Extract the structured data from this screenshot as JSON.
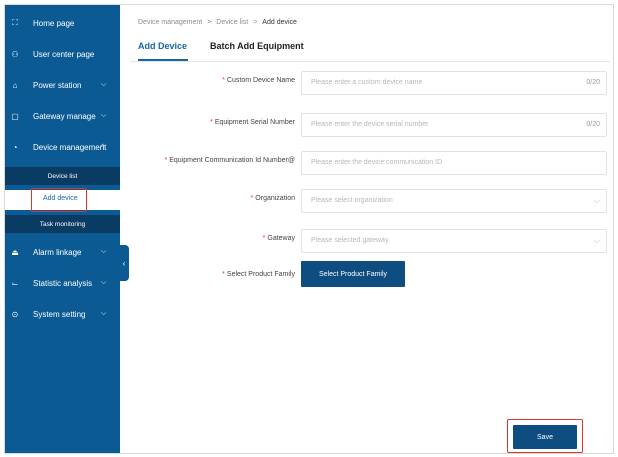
{
  "sidebar": {
    "items": [
      {
        "label": "Home page",
        "icon": "expand-icon",
        "glyph": "⛶",
        "chev": ""
      },
      {
        "label": "User center page",
        "icon": "user-icon",
        "glyph": "⚇",
        "chev": ""
      },
      {
        "label": "Power station",
        "icon": "home-icon",
        "glyph": "⌂",
        "chev": "⌵"
      },
      {
        "label": "Gateway manage",
        "icon": "gateway-icon",
        "glyph": "▢",
        "chev": "⌵"
      },
      {
        "label": "Device management",
        "icon": "device-icon",
        "glyph": "◔",
        "chev": "^"
      },
      {
        "label": "Alarm linkage",
        "icon": "alarm-icon",
        "glyph": "⏏",
        "chev": "⌵"
      },
      {
        "label": "Statistic analysis",
        "icon": "chart-icon",
        "glyph": "⌙",
        "chev": "⌵"
      },
      {
        "label": "System setting",
        "icon": "setting-icon",
        "glyph": "⊙",
        "chev": "⌵"
      }
    ],
    "sub_items": {
      "device_list": "Device list",
      "add_device": "Add device",
      "task_monitoring": "Task monitoring"
    },
    "collapse_glyph": "‹"
  },
  "breadcrumb": {
    "items": [
      "Device management",
      "Device list",
      "Add device"
    ],
    "separator": ">"
  },
  "tabs": {
    "add_device": "Add Device",
    "batch_add": "Batch Add Equipment"
  },
  "form": {
    "required_mark": "*",
    "custom_name": {
      "label": "Custom Device Name",
      "placeholder": "Please enter a custom device name",
      "counter": "0/20"
    },
    "serial_number": {
      "label": "Equipment Serial Number",
      "placeholder": "Please enter the device serial number",
      "counter": "0/20"
    },
    "comm_id": {
      "label": "Equipment Communication Id Number@",
      "placeholder": "Please enter the device communication ID"
    },
    "organization": {
      "label": "Organization",
      "placeholder": "Please select organization"
    },
    "gateway": {
      "label": "Gateway",
      "placeholder": "Please selected gateway"
    },
    "product_family": {
      "label": "Select Product Family",
      "button": "Select Product Family"
    },
    "dropdown_glyph": "⌵"
  },
  "actions": {
    "save": "Save"
  },
  "colors": {
    "sidebar_bg": "#0b5a93",
    "accent": "#1565a8",
    "button_bg": "#0d4d80",
    "highlight": "#e0342a"
  }
}
